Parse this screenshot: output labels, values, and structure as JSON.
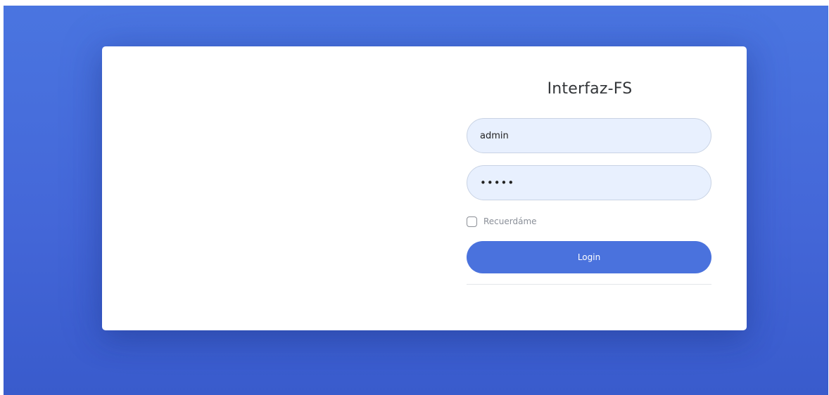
{
  "login": {
    "title": "Interfaz-FS",
    "username_value": "admin",
    "password_value": "•••••",
    "remember_label": "Recuerdáme",
    "remember_checked": false,
    "login_button_label": "Login"
  },
  "colors": {
    "background_gradient_top": "#4a75e0",
    "background_gradient_bottom": "#395bcc",
    "card_background": "#ffffff",
    "input_background": "#e8f0fe",
    "button_accent": "#4a72dd"
  }
}
